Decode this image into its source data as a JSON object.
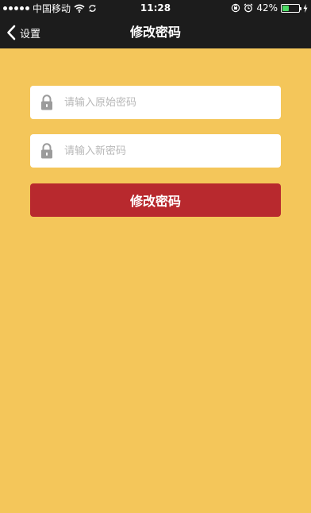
{
  "status_bar": {
    "carrier": "中国移动",
    "time": "11:28",
    "battery_percent": "42%",
    "battery_level": 0.42,
    "icons": [
      "signal-dots-icon",
      "wifi-icon",
      "sync-icon",
      "rotation-lock-icon",
      "alarm-icon",
      "battery-icon",
      "charging-icon"
    ]
  },
  "nav": {
    "back_label": "设置",
    "title": "修改密码",
    "back_icon": "chevron-left-icon"
  },
  "form": {
    "old_password": {
      "placeholder": "请输入原始密码",
      "value": "",
      "icon": "lock-icon"
    },
    "new_password": {
      "placeholder": "请输入新密码",
      "value": "",
      "icon": "lock-icon"
    },
    "submit_label": "修改密码"
  },
  "colors": {
    "background": "#F4C65A",
    "bar": "#1C1C1C",
    "button": "#B8292E",
    "placeholder": "#B8B8B8",
    "lock": "#9B9B9B"
  }
}
